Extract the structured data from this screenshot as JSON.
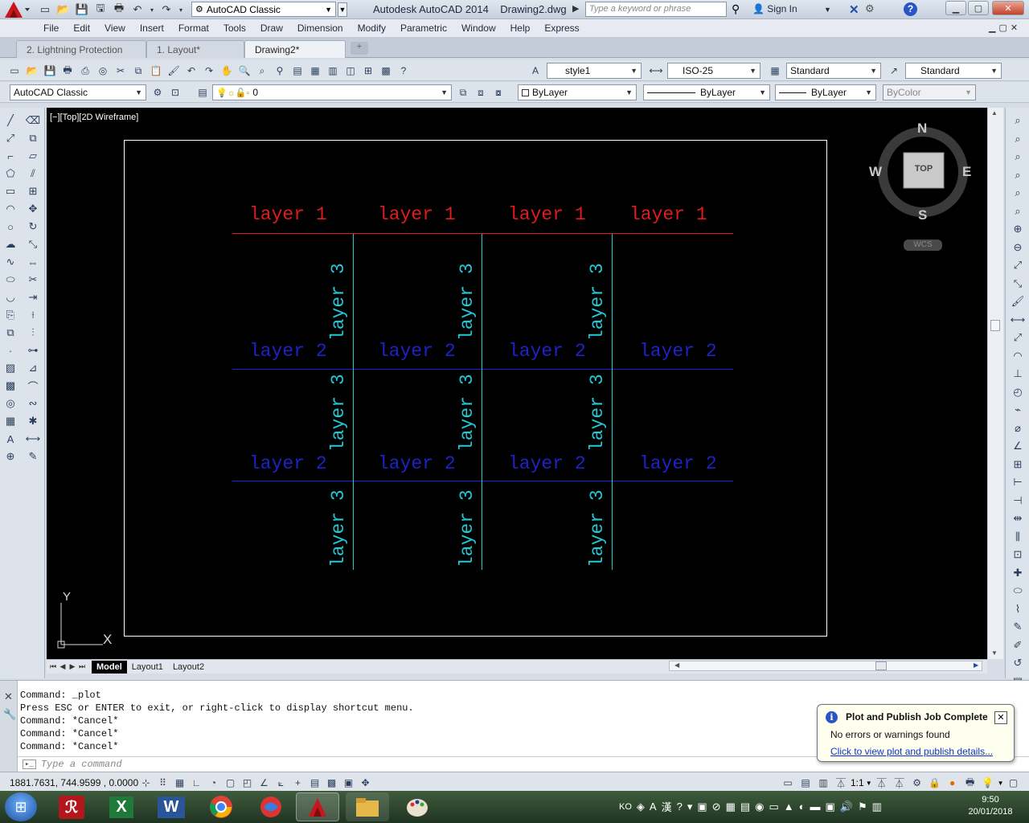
{
  "titlebar": {
    "workspace": "AutoCAD Classic",
    "app_title": "Autodesk AutoCAD 2014",
    "doc_title": "Drawing2.dwg",
    "search_placeholder": "Type a keyword or phrase",
    "sign_in": "Sign In"
  },
  "menu": [
    "File",
    "Edit",
    "View",
    "Insert",
    "Format",
    "Tools",
    "Draw",
    "Dimension",
    "Modify",
    "Parametric",
    "Window",
    "Help",
    "Express"
  ],
  "doc_tabs": [
    "2. Lightning Protection",
    "1. Layout*",
    "Drawing2*"
  ],
  "styles_toolbar": {
    "text_style": "style1",
    "dim_style": "ISO-25",
    "table_style": "Standard",
    "mleader_style": "Standard"
  },
  "layers_toolbar": {
    "workspace": "AutoCAD Classic",
    "layer": "0",
    "color": "ByLayer",
    "linetype": "ByLayer",
    "lineweight": "ByLayer",
    "plotstyle": "ByColor"
  },
  "viewport": {
    "label": "[−][Top][2D Wireframe]"
  },
  "drawing": {
    "layer1_text": "layer 1",
    "layer2_text": "layer 2",
    "layer3_text": "layer 3",
    "layer1_color": "#e11b1b",
    "layer2_color": "#1e22c8",
    "layer3_color": "#23c9d6"
  },
  "viewcube": {
    "north": "N",
    "south": "S",
    "east": "E",
    "west": "W",
    "face": "TOP",
    "ucs": "WCS"
  },
  "ucs_icon": {
    "x": "X",
    "y": "Y"
  },
  "layout_tabs": [
    "Model",
    "Layout1",
    "Layout2"
  ],
  "command": {
    "history": [
      "Command: _plot",
      "Press ESC or ENTER to exit, or right-click to display shortcut menu.",
      "Command: *Cancel*",
      "Command: *Cancel*",
      "Command: *Cancel*"
    ],
    "placeholder": "Type a command"
  },
  "notification": {
    "title": "Plot and Publish Job Complete",
    "message": "No errors or warnings found",
    "link": "Click to view plot and publish details..."
  },
  "status": {
    "coordinates": "1881.7631, 744.9599 , 0.0000",
    "annotation_scale": "1:1"
  },
  "taskbar": {
    "ime": "KO",
    "time": "9:50",
    "date": "20/01/2018"
  }
}
